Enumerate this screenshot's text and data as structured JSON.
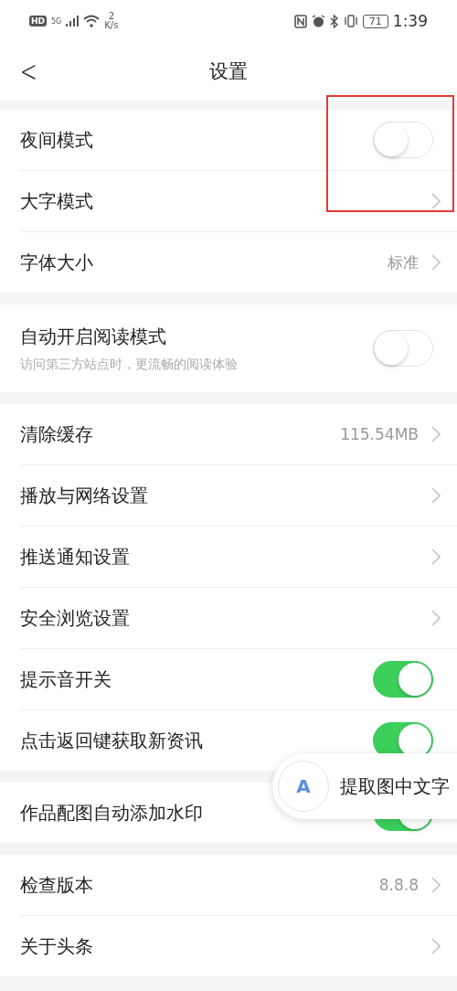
{
  "status_bar": {
    "hd": "HD",
    "network": "5G",
    "speed": "2",
    "speed_unit": "K/s",
    "battery": "71",
    "time": "1:39"
  },
  "header": {
    "back": "<",
    "title": "设置"
  },
  "highlight_box": true,
  "groups": [
    {
      "rows": [
        {
          "kind": "toggle",
          "label": "夜间模式",
          "on": false
        },
        {
          "kind": "link",
          "label": "大字模式"
        },
        {
          "kind": "link",
          "label": "字体大小",
          "value": "标准"
        }
      ]
    },
    {
      "rows": [
        {
          "kind": "toggle",
          "label": "自动开启阅读模式",
          "subtitle": "访问第三方站点时，更流畅的阅读体验",
          "on": false
        }
      ]
    },
    {
      "rows": [
        {
          "kind": "link",
          "label": "清除缓存",
          "value": "115.54MB"
        },
        {
          "kind": "link",
          "label": "播放与网络设置"
        },
        {
          "kind": "link",
          "label": "推送通知设置"
        },
        {
          "kind": "link",
          "label": "安全浏览设置"
        },
        {
          "kind": "toggle",
          "label": "提示音开关",
          "on": true
        },
        {
          "kind": "toggle",
          "label": "点击返回键获取新资讯",
          "on": true
        }
      ]
    },
    {
      "rows": [
        {
          "kind": "toggle",
          "label": "作品配图自动添加水印",
          "on": true
        }
      ]
    },
    {
      "rows": [
        {
          "kind": "link",
          "label": "检查版本",
          "value": "8.8.8"
        },
        {
          "kind": "link",
          "label": "关于头条"
        }
      ]
    }
  ],
  "floating_button": {
    "icon": "A",
    "label": "提取图中文字"
  }
}
